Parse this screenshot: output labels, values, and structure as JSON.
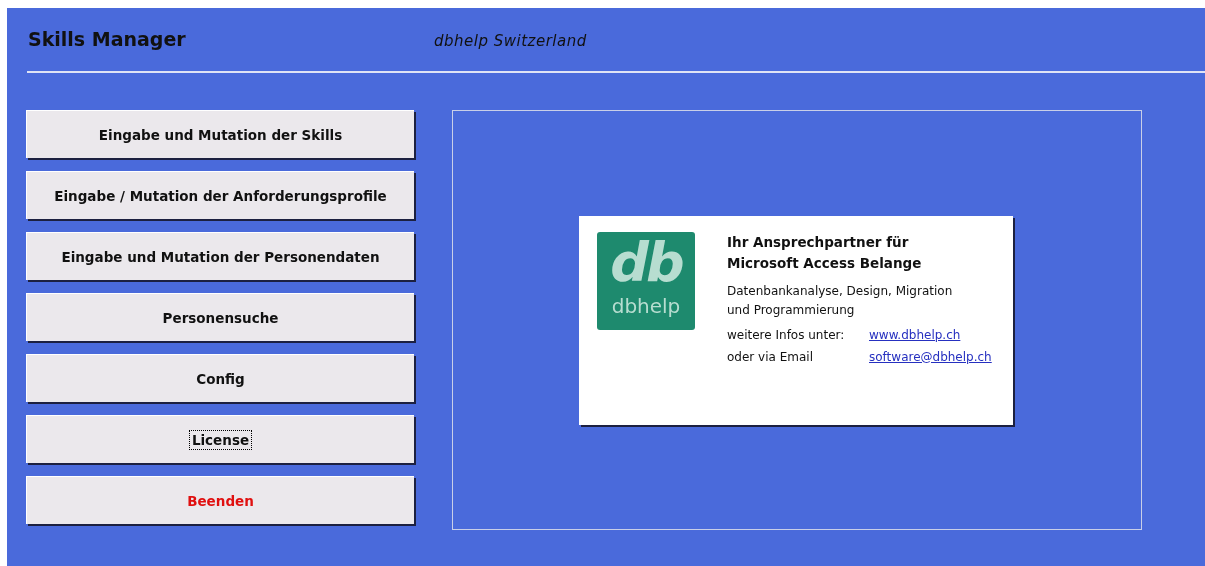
{
  "header": {
    "title": "Skills Manager",
    "subtitle": "dbhelp Switzerland"
  },
  "buttons": [
    {
      "label": "Eingabe und Mutation der Skills",
      "kind": "normal",
      "focused": false
    },
    {
      "label": "Eingabe / Mutation der Anforderungsprofile",
      "kind": "normal",
      "focused": false
    },
    {
      "label": "Eingabe und Mutation der Personendaten",
      "kind": "normal",
      "focused": false
    },
    {
      "label": "Personensuche",
      "kind": "normal",
      "focused": false
    },
    {
      "label": "Config",
      "kind": "normal",
      "focused": false
    },
    {
      "label": "License",
      "kind": "normal",
      "focused": true
    },
    {
      "label": "Beenden",
      "kind": "exit",
      "focused": false
    }
  ],
  "card": {
    "logo": {
      "monogram": "db",
      "name": "dbhelp"
    },
    "heading": [
      "Ihr Ansprechpartner für",
      "Microsoft Access Belange"
    ],
    "description": [
      "Datenbankanalyse, Design, Migration",
      "und Programmierung"
    ],
    "contacts": [
      {
        "label": "weitere Infos unter:",
        "link": "www.dbhelp.ch"
      },
      {
        "label": "oder via Email",
        "link": "software@dbhelp.ch"
      }
    ]
  }
}
